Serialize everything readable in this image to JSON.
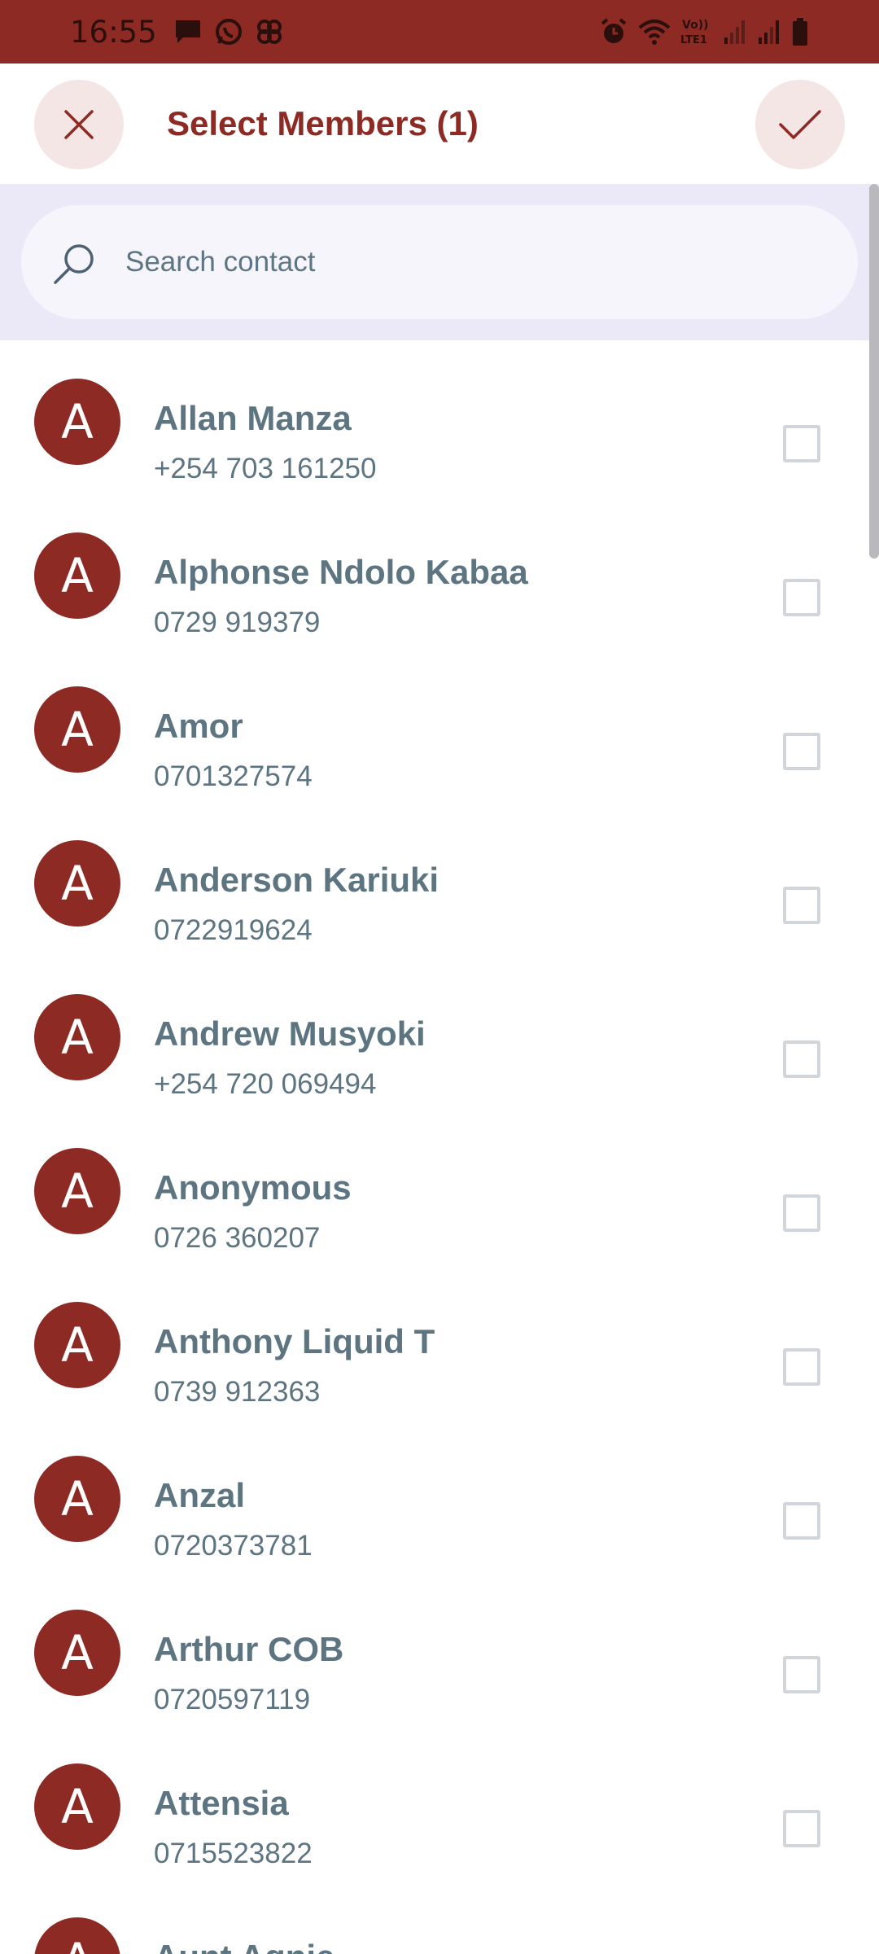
{
  "status_bar": {
    "time": "16:55",
    "left_icons": [
      "message-icon",
      "whatsapp-icon",
      "pinwheel-icon"
    ],
    "right_icons": [
      "alarm-icon",
      "wifi-icon",
      "volte-icon",
      "signal-icon",
      "signal-icon",
      "battery-icon"
    ],
    "volte_label": "Vo)) LTE1"
  },
  "header": {
    "title": "Select Members (1)",
    "close_icon": "close-icon",
    "confirm_icon": "check-icon"
  },
  "search": {
    "placeholder": "Search contact",
    "value": ""
  },
  "contacts": [
    {
      "initial": "A",
      "name": "Allan Manza",
      "phone": "+254 703 161250",
      "checked": false
    },
    {
      "initial": "A",
      "name": "Alphonse Ndolo Kabaa",
      "phone": "0729 919379",
      "checked": false
    },
    {
      "initial": "A",
      "name": "Amor",
      "phone": "0701327574",
      "checked": false
    },
    {
      "initial": "A",
      "name": "Anderson Kariuki",
      "phone": "0722919624",
      "checked": false
    },
    {
      "initial": "A",
      "name": "Andrew Musyoki",
      "phone": "+254 720 069494",
      "checked": false
    },
    {
      "initial": "A",
      "name": "Anonymous",
      "phone": "0726 360207",
      "checked": false
    },
    {
      "initial": "A",
      "name": "Anthony Liquid T",
      "phone": "0739 912363",
      "checked": false
    },
    {
      "initial": "A",
      "name": "Anzal",
      "phone": "0720373781",
      "checked": false
    },
    {
      "initial": "A",
      "name": "Arthur COB",
      "phone": "0720597119",
      "checked": false
    },
    {
      "initial": "A",
      "name": "Attensia",
      "phone": "0715523822",
      "checked": false
    },
    {
      "initial": "A",
      "name": "Aunt Agnie",
      "phone": "",
      "checked": false
    }
  ],
  "colors": {
    "brand": "#8e2a24",
    "header_button_bg": "#f3e6e5",
    "search_panel_bg": "#ebe9f8",
    "text_slate": "#5d7481"
  }
}
